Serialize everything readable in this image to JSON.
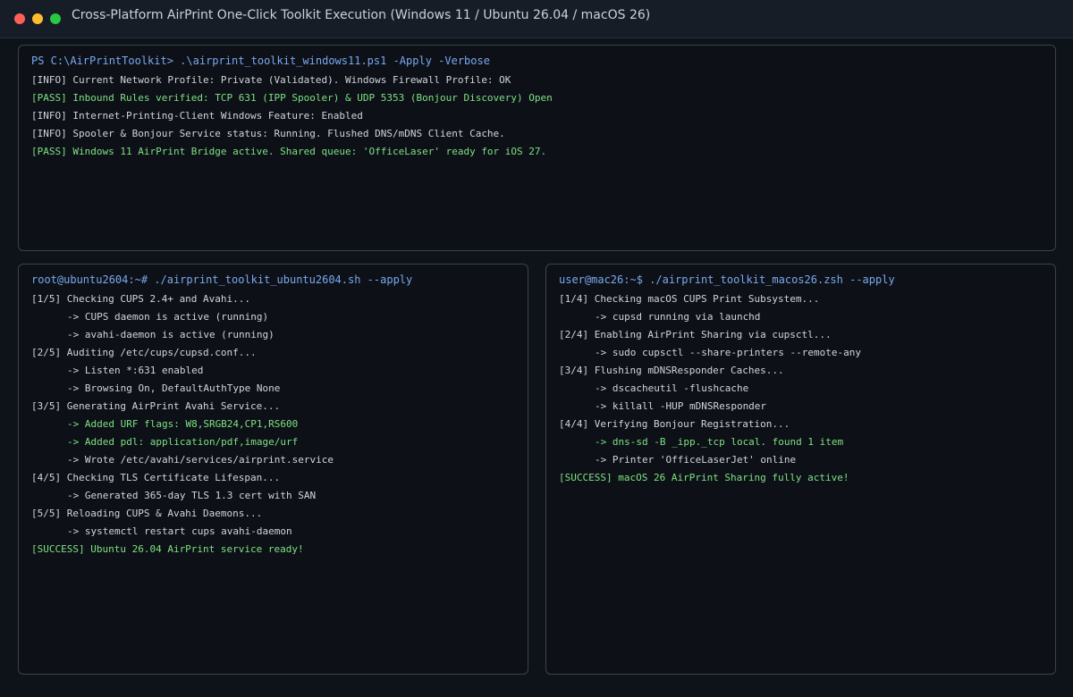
{
  "window": {
    "title": "Cross-Platform AirPrint One-Click Toolkit Execution (Windows 11 / Ubuntu 26.04 / macOS 26)"
  },
  "colors": {
    "prompt": "#79a8f0",
    "pass": "#7ee083",
    "info": "#d0d5dc",
    "background": "#0d1117"
  },
  "windows_pane": {
    "prompt": "PS C:\\AirPrintToolkit> .\\airprint_toolkit_windows11.ps1 -Apply -Verbose",
    "lines": [
      {
        "text": "[INFO] Current Network Profile: Private (Validated). Windows Firewall Profile: OK",
        "status": "info"
      },
      {
        "text": "[PASS] Inbound Rules verified: TCP 631 (IPP Spooler) & UDP 5353 (Bonjour Discovery) Open",
        "status": "pass"
      },
      {
        "text": "[INFO] Internet-Printing-Client Windows Feature: Enabled",
        "status": "info"
      },
      {
        "text": "[INFO] Spooler & Bonjour Service status: Running. Flushed DNS/mDNS Client Cache.",
        "status": "info"
      },
      {
        "text": "[PASS] Windows 11 AirPrint Bridge active. Shared queue: 'OfficeLaser' ready for iOS 27.",
        "status": "pass"
      }
    ]
  },
  "ubuntu_pane": {
    "prompt": "root@ubuntu2604:~# ./airprint_toolkit_ubuntu2604.sh --apply",
    "lines": [
      {
        "text": "[1/5] Checking CUPS 2.4+ and Avahi...",
        "status": "info"
      },
      {
        "text": "-> CUPS daemon is active (running)",
        "status": "info",
        "indent": true
      },
      {
        "text": "-> avahi-daemon is active (running)",
        "status": "info",
        "indent": true
      },
      {
        "text": "[2/5] Auditing /etc/cups/cupsd.conf...",
        "status": "info"
      },
      {
        "text": "-> Listen *:631 enabled",
        "status": "info",
        "indent": true
      },
      {
        "text": "-> Browsing On, DefaultAuthType None",
        "status": "info",
        "indent": true
      },
      {
        "text": "[3/5] Generating AirPrint Avahi Service...",
        "status": "info"
      },
      {
        "text": "-> Added URF flags: W8,SRGB24,CP1,RS600",
        "status": "pass",
        "indent": true
      },
      {
        "text": "-> Added pdl: application/pdf,image/urf",
        "status": "pass",
        "indent": true
      },
      {
        "text": "-> Wrote /etc/avahi/services/airprint.service",
        "status": "info",
        "indent": true
      },
      {
        "text": "[4/5] Checking TLS Certificate Lifespan...",
        "status": "info"
      },
      {
        "text": "-> Generated 365-day TLS 1.3 cert with SAN",
        "status": "info",
        "indent": true
      },
      {
        "text": "[5/5] Reloading CUPS & Avahi Daemons...",
        "status": "info"
      },
      {
        "text": "-> systemctl restart cups avahi-daemon",
        "status": "info",
        "indent": true
      },
      {
        "text": "[SUCCESS] Ubuntu 26.04 AirPrint service ready!",
        "status": "pass"
      }
    ]
  },
  "mac_pane": {
    "prompt": "user@mac26:~$ ./airprint_toolkit_macos26.zsh --apply",
    "lines": [
      {
        "text": "[1/4] Checking macOS CUPS Print Subsystem...",
        "status": "info"
      },
      {
        "text": "-> cupsd running via launchd",
        "status": "info",
        "indent": true
      },
      {
        "text": "[2/4] Enabling AirPrint Sharing via cupsctl...",
        "status": "info"
      },
      {
        "text": "-> sudo cupsctl --share-printers --remote-any",
        "status": "info",
        "indent": true
      },
      {
        "text": "[3/4] Flushing mDNSResponder Caches...",
        "status": "info"
      },
      {
        "text": "-> dscacheutil -flushcache",
        "status": "info",
        "indent": true
      },
      {
        "text": "-> killall -HUP mDNSResponder",
        "status": "info",
        "indent": true
      },
      {
        "text": "[4/4] Verifying Bonjour Registration...",
        "status": "info"
      },
      {
        "text": "-> dns-sd -B _ipp._tcp local. found 1 item",
        "status": "pass",
        "indent": true
      },
      {
        "text": "-> Printer 'OfficeLaserJet' online",
        "status": "info",
        "indent": true
      },
      {
        "text": "[SUCCESS] macOS 26 AirPrint Sharing fully active!",
        "status": "pass"
      }
    ]
  }
}
